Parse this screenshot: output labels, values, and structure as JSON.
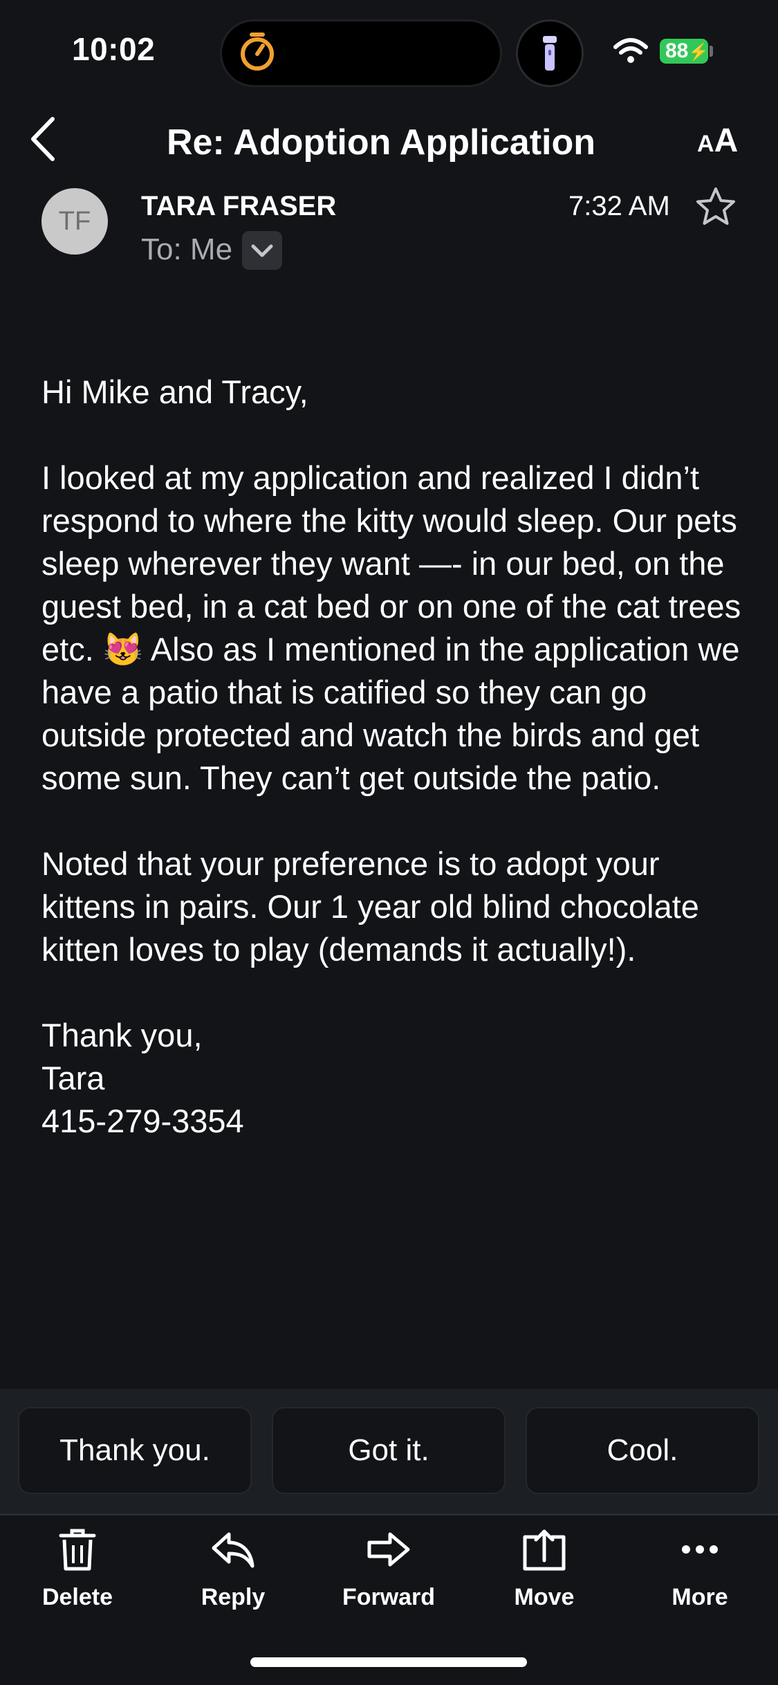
{
  "status_bar": {
    "time": "10:02",
    "battery": "88",
    "icons": [
      "timer-icon",
      "flashlight-icon",
      "wifi-icon",
      "battery-charging-icon"
    ]
  },
  "header": {
    "subject": "Re: Adoption Application",
    "back_icon": "chevron-left-icon",
    "text_size_icon": "text-size-icon"
  },
  "message": {
    "avatar_initials": "TF",
    "sender": "TARA FRASER",
    "to": "To: Me",
    "time": "7:32 AM",
    "star_icon": "star-outline-icon",
    "body": [
      "Hi Mike and Tracy,",
      "I looked at my application and realized I didn’t respond to where the kitty would sleep.  Our pets sleep wherever they want —- in our bed, on the guest bed, in a cat bed or on one of the cat trees etc. 😻 Also as I mentioned in the application we have a patio that is catified so they can go outside protected and watch the birds and get some sun. They can’t get outside the patio.",
      "Noted that your preference is to adopt your kittens in pairs.  Our 1 year old blind chocolate kitten loves to play (demands it actually!).",
      "Thank you,\nTara\n415-279-3354"
    ]
  },
  "quick_replies": [
    "Thank you.",
    "Got it.",
    "Cool."
  ],
  "toolbar": [
    {
      "label": "Delete",
      "icon": "trash-icon"
    },
    {
      "label": "Reply",
      "icon": "reply-icon"
    },
    {
      "label": "Forward",
      "icon": "forward-icon"
    },
    {
      "label": "Move",
      "icon": "move-icon"
    },
    {
      "label": "More",
      "icon": "more-icon"
    }
  ],
  "colors": {
    "background": "#121418",
    "panel": "#1c1f24",
    "battery": "#33c759",
    "timer": "#f0a030",
    "muted_text": "#a8abb2"
  }
}
